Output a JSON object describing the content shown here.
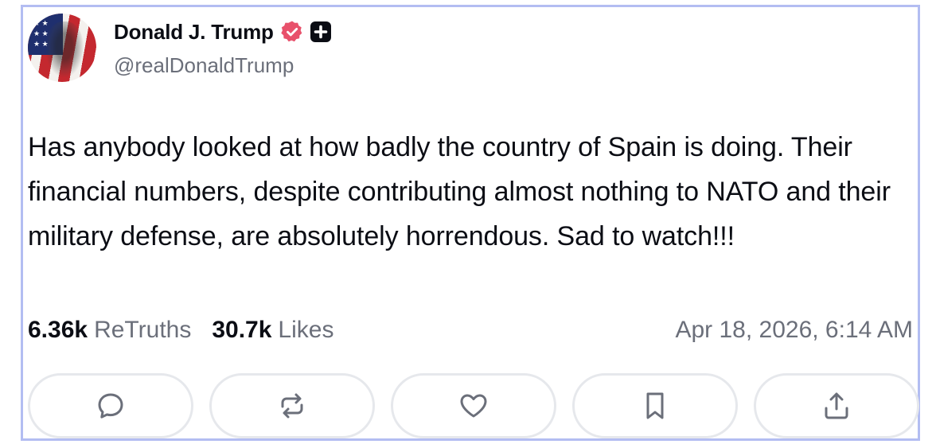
{
  "post": {
    "author_name": "Donald J. Trump",
    "handle": "@realDonaldTrump",
    "body": "Has anybody looked at how badly the country of Spain is doing. Their financial numbers, despite contributing almost nothing to NATO and their military defense, are absolutely horrendous. Sad to watch!!!",
    "retruths_count": "6.36k",
    "retruths_label": "ReTruths",
    "likes_count": "30.7k",
    "likes_label": "Likes",
    "timestamp": "Apr 18, 2026, 6:14 AM"
  },
  "icons": {
    "verified": "verified-badge-icon",
    "plus": "plus-badge-icon",
    "reply": "reply-icon",
    "retruth": "retruth-icon",
    "like": "heart-icon",
    "bookmark": "bookmark-icon",
    "share": "share-icon"
  },
  "colors": {
    "card_border": "#b3bdf2",
    "verified": "#e8516b",
    "text_primary": "#0b0d14",
    "text_secondary": "#6b6f7a",
    "action_border": "#e6e8ec",
    "icon_gray": "#6b6f7a"
  }
}
